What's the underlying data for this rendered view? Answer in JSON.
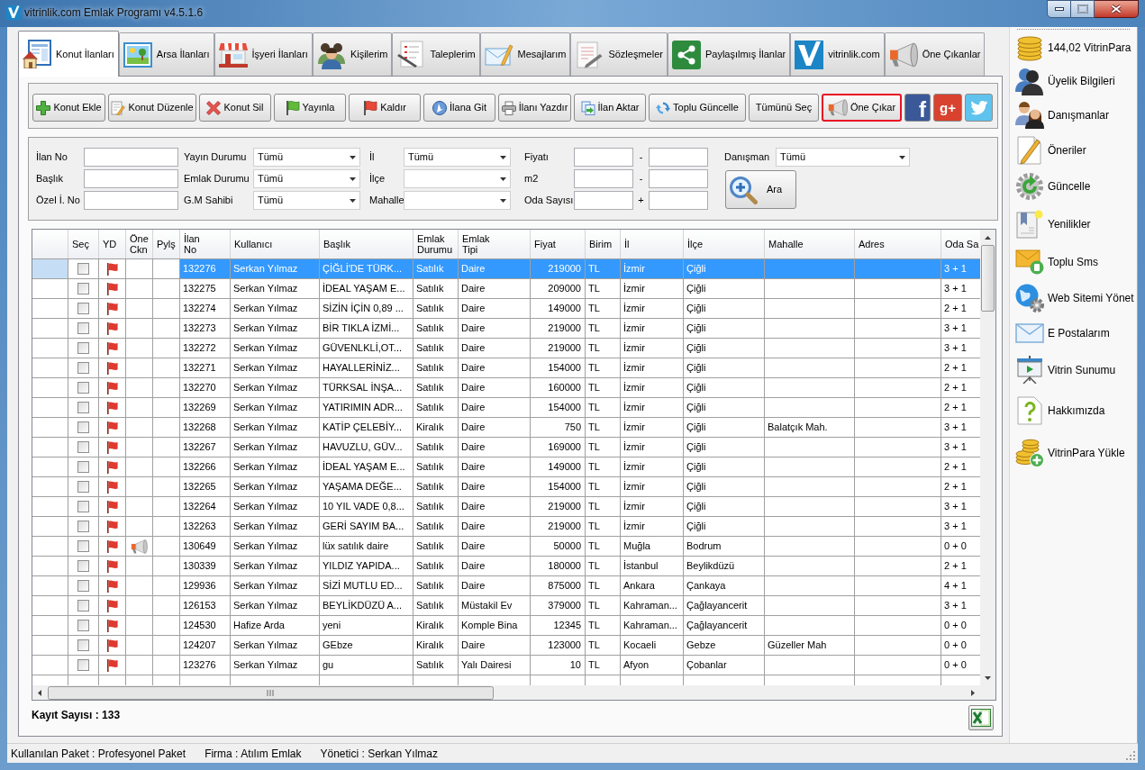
{
  "window": {
    "title": "vitrinlik.com Emlak Programı v4.5.1.6"
  },
  "tabs": [
    {
      "label": "Konut İlanları",
      "selected": true
    },
    {
      "label": "Arsa İlanları",
      "selected": false
    },
    {
      "label": "İşyeri İlanları",
      "selected": false
    },
    {
      "label": "Kişilerim",
      "selected": false
    },
    {
      "label": "Taleplerim",
      "selected": false
    },
    {
      "label": "Mesajlarım",
      "selected": false
    },
    {
      "label": "Sözleşmeler",
      "selected": false
    },
    {
      "label": "Paylaşılmış İlanlar",
      "selected": false
    },
    {
      "label": "vitrinlik.com",
      "selected": false
    },
    {
      "label": "Öne Çıkanlar",
      "selected": false
    }
  ],
  "toolbar": {
    "buttons": [
      {
        "label": "Konut Ekle",
        "highlighted": false
      },
      {
        "label": "Konut Düzenle",
        "highlighted": false
      },
      {
        "label": "Konut Sil",
        "highlighted": false
      },
      {
        "label": "Yayınla",
        "highlighted": false
      },
      {
        "label": "Kaldır",
        "highlighted": false
      },
      {
        "label": "İlana Git",
        "highlighted": false
      },
      {
        "label": "İlanı Yazdır",
        "highlighted": false
      },
      {
        "label": "İlan Aktar",
        "highlighted": false
      },
      {
        "label": "Toplu Güncelle",
        "highlighted": false
      },
      {
        "label": "Tümünü Seç",
        "highlighted": false
      },
      {
        "label": "Öne Çıkar",
        "highlighted": true
      }
    ],
    "share_buttons": [
      {
        "kind": "facebook",
        "text": "f"
      },
      {
        "kind": "google_plus",
        "text": "g+"
      },
      {
        "kind": "twitter"
      }
    ]
  },
  "filter_panel": {
    "rows": [
      [
        {
          "label": "İlan No",
          "kind": "text"
        },
        {
          "label": "Yayın Durumu",
          "kind": "select",
          "value": "Tümü"
        },
        {
          "label": "İl",
          "kind": "select",
          "value": "Tümü"
        },
        {
          "label": "Fiyatı",
          "kind": "range",
          "separator": "-"
        },
        {
          "label": "Danışman",
          "kind": "select",
          "value": "Tümü"
        }
      ],
      [
        {
          "label": "Başlık",
          "kind": "text"
        },
        {
          "label": "Emlak Durumu",
          "kind": "select",
          "value": "Tümü"
        },
        {
          "label": "İlçe",
          "kind": "select"
        },
        {
          "label": "m2",
          "kind": "range",
          "separator": "-"
        }
      ],
      [
        {
          "label": "Özel İ. No",
          "kind": "text"
        },
        {
          "label": "G.M Sahibi",
          "kind": "select",
          "value": "Tümü"
        },
        {
          "label": "Mahalle",
          "kind": "select"
        },
        {
          "label": "Oda Sayısı",
          "kind": "range",
          "separator": "+"
        }
      ]
    ],
    "search_button": {
      "label": "Ara"
    }
  },
  "table": {
    "columns": [
      {
        "label": "Seç",
        "kind": "checkbox"
      },
      {
        "label": "YD",
        "kind": "flag"
      },
      {
        "label": "Öne\nCkn",
        "kind": "featured"
      },
      {
        "label": "Pylş",
        "kind": "shared"
      },
      {
        "label": "İlan\nNo",
        "kind": "text"
      },
      {
        "label": "Kullanıcı",
        "kind": "text"
      },
      {
        "label": "Başlık",
        "kind": "text"
      },
      {
        "label": "Emlak\nDurumu",
        "kind": "text"
      },
      {
        "label": "Emlak\nTipi",
        "kind": "text"
      },
      {
        "label": "Fiyat",
        "kind": "number"
      },
      {
        "label": "Birim",
        "kind": "text"
      },
      {
        "label": "İl",
        "kind": "text"
      },
      {
        "label": "İlçe",
        "kind": "text"
      },
      {
        "label": "Mahalle",
        "kind": "text"
      },
      {
        "label": "Adres",
        "kind": "text"
      },
      {
        "label": "Oda Sa",
        "kind": "text"
      }
    ],
    "rows": [
      {
        "selected": true,
        "checked": false,
        "published": false,
        "featured": false,
        "ilan_no": "132276",
        "user": "Serkan Yılmaz",
        "title": "ÇİĞLİ'DE TÜRK...",
        "status": "Satılık",
        "type": "Daire",
        "price": "219000",
        "unit": "TL",
        "city": "İzmir",
        "district": "Çiğli",
        "rooms": "3 + 1"
      },
      {
        "selected": false,
        "checked": false,
        "published": false,
        "featured": false,
        "ilan_no": "132275",
        "user": "Serkan Yılmaz",
        "title": "İDEAL YAŞAM E...",
        "status": "Satılık",
        "type": "Daire",
        "price": "209000",
        "unit": "TL",
        "city": "İzmir",
        "district": "Çiğli",
        "rooms": "3 + 1"
      },
      {
        "selected": false,
        "checked": false,
        "published": false,
        "featured": false,
        "ilan_no": "132274",
        "user": "Serkan Yılmaz",
        "title": "SİZİN İÇİN 0,89 ...",
        "status": "Satılık",
        "type": "Daire",
        "price": "149000",
        "unit": "TL",
        "city": "İzmir",
        "district": "Çiğli",
        "rooms": "2 + 1"
      },
      {
        "selected": false,
        "checked": false,
        "published": false,
        "featured": false,
        "ilan_no": "132273",
        "user": "Serkan Yılmaz",
        "title": "BİR TIKLA İZMİ...",
        "status": "Satılık",
        "type": "Daire",
        "price": "219000",
        "unit": "TL",
        "city": "İzmir",
        "district": "Çiğli",
        "rooms": "3 + 1"
      },
      {
        "selected": false,
        "checked": false,
        "published": false,
        "featured": false,
        "ilan_no": "132272",
        "user": "Serkan Yılmaz",
        "title": "GÜVENLKLİ,OT...",
        "status": "Satılık",
        "type": "Daire",
        "price": "219000",
        "unit": "TL",
        "city": "İzmir",
        "district": "Çiğli",
        "rooms": "3 + 1"
      },
      {
        "selected": false,
        "checked": false,
        "published": false,
        "featured": false,
        "ilan_no": "132271",
        "user": "Serkan Yılmaz",
        "title": "HAYALLERİNİZ...",
        "status": "Satılık",
        "type": "Daire",
        "price": "154000",
        "unit": "TL",
        "city": "İzmir",
        "district": "Çiğli",
        "rooms": "2 + 1"
      },
      {
        "selected": false,
        "checked": false,
        "published": false,
        "featured": false,
        "ilan_no": "132270",
        "user": "Serkan Yılmaz",
        "title": "TÜRKSAL İNŞA...",
        "status": "Satılık",
        "type": "Daire",
        "price": "160000",
        "unit": "TL",
        "city": "İzmir",
        "district": "Çiğli",
        "rooms": "2 + 1"
      },
      {
        "selected": false,
        "checked": false,
        "published": false,
        "featured": false,
        "ilan_no": "132269",
        "user": "Serkan Yılmaz",
        "title": "YATIRIMIN ADR...",
        "status": "Satılık",
        "type": "Daire",
        "price": "154000",
        "unit": "TL",
        "city": "İzmir",
        "district": "Çiğli",
        "rooms": "2 + 1"
      },
      {
        "selected": false,
        "checked": false,
        "published": false,
        "featured": false,
        "ilan_no": "132268",
        "user": "Serkan Yılmaz",
        "title": "KATİP ÇELEBİY...",
        "status": "Kiralık",
        "type": "Daire",
        "price": "750",
        "unit": "TL",
        "city": "İzmir",
        "district": "Çiğli",
        "neighborhood": "Balatçık Mah.",
        "rooms": "3 + 1"
      },
      {
        "selected": false,
        "checked": false,
        "published": false,
        "featured": false,
        "ilan_no": "132267",
        "user": "Serkan Yılmaz",
        "title": "HAVUZLU, GÜV...",
        "status": "Satılık",
        "type": "Daire",
        "price": "169000",
        "unit": "TL",
        "city": "İzmir",
        "district": "Çiğli",
        "rooms": "3 + 1"
      },
      {
        "selected": false,
        "checked": false,
        "published": false,
        "featured": false,
        "ilan_no": "132266",
        "user": "Serkan Yılmaz",
        "title": "İDEAL YAŞAM E...",
        "status": "Satılık",
        "type": "Daire",
        "price": "149000",
        "unit": "TL",
        "city": "İzmir",
        "district": "Çiğli",
        "rooms": "2 + 1"
      },
      {
        "selected": false,
        "checked": false,
        "published": false,
        "featured": false,
        "ilan_no": "132265",
        "user": "Serkan Yılmaz",
        "title": "YAŞAMA DEĞE...",
        "status": "Satılık",
        "type": "Daire",
        "price": "154000",
        "unit": "TL",
        "city": "İzmir",
        "district": "Çiğli",
        "rooms": "2 + 1"
      },
      {
        "selected": false,
        "checked": false,
        "published": false,
        "featured": false,
        "ilan_no": "132264",
        "user": "Serkan Yılmaz",
        "title": "10 YIL VADE 0,8...",
        "status": "Satılık",
        "type": "Daire",
        "price": "219000",
        "unit": "TL",
        "city": "İzmir",
        "district": "Çiğli",
        "rooms": "3 + 1"
      },
      {
        "selected": false,
        "checked": false,
        "published": false,
        "featured": false,
        "ilan_no": "132263",
        "user": "Serkan Yılmaz",
        "title": "GERİ SAYIM BA...",
        "status": "Satılık",
        "type": "Daire",
        "price": "219000",
        "unit": "TL",
        "city": "İzmir",
        "district": "Çiğli",
        "rooms": "3 + 1"
      },
      {
        "selected": false,
        "checked": false,
        "published": false,
        "featured": true,
        "ilan_no": "130649",
        "user": "Serkan Yılmaz",
        "title": "lüx satılık daire",
        "status": "Satılık",
        "type": "Daire",
        "price": "50000",
        "unit": "TL",
        "city": "Muğla",
        "district": "Bodrum",
        "rooms": "0 + 0"
      },
      {
        "selected": false,
        "checked": false,
        "published": false,
        "featured": false,
        "ilan_no": "130339",
        "user": "Serkan Yılmaz",
        "title": "YILDIZ YAPIDA...",
        "status": "Satılık",
        "type": "Daire",
        "price": "180000",
        "unit": "TL",
        "city": "İstanbul",
        "district": "Beylikdüzü",
        "rooms": "2 + 1"
      },
      {
        "selected": false,
        "checked": false,
        "published": false,
        "featured": false,
        "ilan_no": "129936",
        "user": "Serkan Yılmaz",
        "title": "SİZİ MUTLU ED...",
        "status": "Satılık",
        "type": "Daire",
        "price": "875000",
        "unit": "TL",
        "city": "Ankara",
        "district": "Çankaya",
        "rooms": "4 + 1"
      },
      {
        "selected": false,
        "checked": false,
        "published": false,
        "featured": false,
        "ilan_no": "126153",
        "user": "Serkan Yılmaz",
        "title": "BEYLİKDÜZÜ A...",
        "status": "Satılık",
        "type": "Müstakil Ev",
        "price": "379000",
        "unit": "TL",
        "city": "Kahraman...",
        "district": "Çağlayancerit",
        "rooms": "3 + 1"
      },
      {
        "selected": false,
        "checked": false,
        "published": false,
        "featured": false,
        "ilan_no": "124530",
        "user": "Hafize Arda",
        "title": "yeni",
        "status": "Kiralık",
        "type": "Komple Bina",
        "price": "12345",
        "unit": "TL",
        "city": "Kahraman...",
        "district": "Çağlayancerit",
        "rooms": "0 + 0"
      },
      {
        "selected": false,
        "checked": false,
        "published": false,
        "featured": false,
        "ilan_no": "124207",
        "user": "Serkan Yılmaz",
        "title": "GEbze",
        "status": "Kiralık",
        "type": "Daire",
        "price": "123000",
        "unit": "TL",
        "city": "Kocaeli",
        "district": "Gebze",
        "neighborhood": "Güzeller Mah",
        "rooms": "0 + 0"
      },
      {
        "selected": false,
        "checked": false,
        "published": false,
        "featured": false,
        "ilan_no": "123276",
        "user": "Serkan Yılmaz",
        "title": "gu",
        "status": "Satılık",
        "type": "Yalı Dairesi",
        "price": "10",
        "unit": "TL",
        "city": "Afyon",
        "district": "Çobanlar",
        "rooms": "0 + 0"
      }
    ],
    "record_count": "Kayıt Sayısı : 133"
  },
  "sidebar": [
    {
      "label": "144,02 VitrinPara"
    },
    {
      "label": "Üyelik Bilgileri"
    },
    {
      "label": "Danışmanlar"
    },
    {
      "label": "Öneriler"
    },
    {
      "label": "Güncelle"
    },
    {
      "label": "Yenilikler"
    },
    {
      "label": "Toplu Sms"
    },
    {
      "label": "Web Sitemi Yönet"
    },
    {
      "label": "E Postalarım"
    },
    {
      "label": "Vitrin Sunumu"
    },
    {
      "label": "Hakkımızda"
    },
    {
      "label": "VitrinPara Yükle"
    }
  ],
  "status_bar": [
    "Kullanılan Paket : Profesyonel Paket",
    "Firma : Atılım Emlak",
    "Yönetici : Serkan Yılmaz"
  ]
}
